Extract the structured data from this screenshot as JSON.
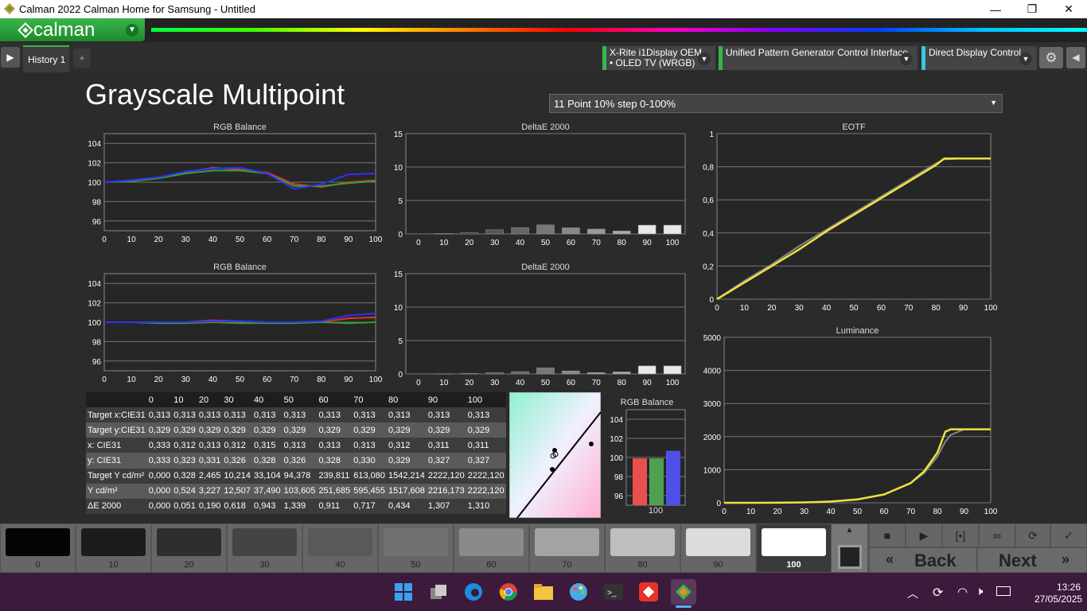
{
  "window": {
    "title": "Calman 2022 Calman Home for Samsung  - Untitled",
    "controls": [
      "—",
      "❐",
      "✕"
    ]
  },
  "app": {
    "logo_text": "calman"
  },
  "tabs": {
    "history": "History 1",
    "add": "+"
  },
  "devices": {
    "meter": [
      "X-Rite i1Display OEM",
      "• OLED TV (WRGB)"
    ],
    "generator": "Unified Pattern Generator Control Interface",
    "display": "Direct Display Control"
  },
  "page": {
    "title": "Grayscale Multipoint",
    "preset": "11 Point 10% step 0-100%"
  },
  "charts": {
    "rgb1_title": "RGB Balance",
    "delta1_title": "DeltaE 2000",
    "eotf_title": "EOTF",
    "rgb2_title": "RGB Balance",
    "delta2_title": "DeltaE 2000",
    "lum_title": "Luminance",
    "rgbbar_title": "RGB Balance",
    "rgbbar_label": "100"
  },
  "chart_data": [
    {
      "type": "line",
      "title": "RGB Balance",
      "x": [
        0,
        10,
        20,
        30,
        40,
        50,
        60,
        70,
        80,
        90,
        100
      ],
      "ylim": [
        95,
        105
      ],
      "series": [
        {
          "color": "#e03030",
          "values": [
            100,
            100.2,
            100.5,
            101,
            101.5,
            101.3,
            101,
            99.8,
            99.5,
            100,
            100.2
          ]
        },
        {
          "color": "#30a030",
          "values": [
            100,
            100.1,
            100.4,
            100.9,
            101.2,
            101.2,
            100.9,
            99.6,
            99.6,
            99.9,
            100.1
          ]
        },
        {
          "color": "#3030ff",
          "values": [
            100,
            100.2,
            100.5,
            101.1,
            101.4,
            101.5,
            100.9,
            99.3,
            99.8,
            100.8,
            100.9
          ]
        }
      ]
    },
    {
      "type": "bar",
      "title": "DeltaE 2000",
      "categories": [
        "0",
        "10",
        "20",
        "30",
        "40",
        "50",
        "60",
        "70",
        "80",
        "90",
        "100"
      ],
      "values": [
        0,
        0.05,
        0.19,
        0.62,
        0.94,
        1.34,
        0.91,
        0.72,
        0.43,
        1.31,
        1.31
      ],
      "ylim": [
        0,
        15
      ]
    },
    {
      "type": "line",
      "title": "EOTF",
      "x": [
        0,
        10,
        20,
        30,
        40,
        50,
        60,
        70,
        80,
        83,
        90,
        100
      ],
      "ylim": [
        0,
        1
      ],
      "series": [
        {
          "color": "#888888",
          "values": [
            0,
            0.11,
            0.21,
            0.32,
            0.42,
            0.52,
            0.62,
            0.72,
            0.82,
            0.845,
            0.85,
            0.85
          ]
        },
        {
          "color": "#f0e040",
          "values": [
            0,
            0.1,
            0.2,
            0.3,
            0.41,
            0.51,
            0.61,
            0.71,
            0.81,
            0.85,
            0.85,
            0.85
          ]
        }
      ]
    },
    {
      "type": "line",
      "title": "RGB Balance",
      "x": [
        0,
        10,
        20,
        30,
        40,
        50,
        60,
        70,
        80,
        90,
        100
      ],
      "ylim": [
        95,
        105
      ],
      "series": [
        {
          "color": "#e03030",
          "values": [
            100,
            100,
            100,
            100,
            100.2,
            100.1,
            100,
            100,
            100,
            100.4,
            100.5
          ]
        },
        {
          "color": "#30a030",
          "values": [
            100,
            100,
            99.9,
            99.9,
            100,
            99.9,
            99.9,
            99.9,
            100,
            99.9,
            100
          ]
        },
        {
          "color": "#3030ff",
          "values": [
            100,
            100,
            100,
            100,
            100.1,
            100.1,
            100,
            100,
            100.1,
            100.7,
            100.9
          ]
        }
      ]
    },
    {
      "type": "bar",
      "title": "DeltaE 2000",
      "categories": [
        "0",
        "10",
        "20",
        "30",
        "40",
        "50",
        "60",
        "70",
        "80",
        "90",
        "100"
      ],
      "values": [
        0,
        0.02,
        0.1,
        0.2,
        0.35,
        0.9,
        0.45,
        0.2,
        0.3,
        1.2,
        1.2
      ],
      "ylim": [
        0,
        15
      ]
    },
    {
      "type": "line",
      "title": "Luminance",
      "x": [
        0,
        10,
        20,
        30,
        40,
        50,
        60,
        70,
        75,
        80,
        83,
        85,
        90,
        100
      ],
      "ylim": [
        0,
        5000
      ],
      "series": [
        {
          "color": "#888888",
          "values": [
            0,
            0.5,
            3,
            12.5,
            37,
            104,
            252,
            595,
            900,
            1400,
            1850,
            2050,
            2222,
            2222
          ]
        },
        {
          "color": "#f0e040",
          "values": [
            0,
            0.5,
            3.2,
            12.5,
            37.5,
            103.6,
            251.7,
            595.5,
            950,
            1517,
            2150,
            2222,
            2222,
            2222
          ]
        }
      ]
    },
    {
      "type": "bar",
      "title": "RGB Balance",
      "categories": [
        "100"
      ],
      "series": [
        {
          "color": "#e85050",
          "values": [
            99.9
          ]
        },
        {
          "color": "#50a050",
          "values": [
            99.9
          ]
        },
        {
          "color": "#5050e8",
          "values": [
            100.7
          ]
        }
      ],
      "ylim": [
        95,
        105
      ]
    }
  ],
  "table": {
    "headers": [
      "",
      "0",
      "10",
      "20",
      "30",
      "40",
      "50",
      "60",
      "70",
      "80",
      "90",
      "100"
    ],
    "rows": [
      [
        "Target x:CIE31",
        "0,313",
        "0,313",
        "0,313",
        "0,313",
        "0,313",
        "0,313",
        "0,313",
        "0,313",
        "0,313",
        "0,313",
        "0,313"
      ],
      [
        "Target y:CIE31",
        "0,329",
        "0,329",
        "0,329",
        "0,329",
        "0,329",
        "0,329",
        "0,329",
        "0,329",
        "0,329",
        "0,329",
        "0,329"
      ],
      [
        "x: CIE31",
        "0,333",
        "0,312",
        "0,313",
        "0,312",
        "0,315",
        "0,313",
        "0,313",
        "0,313",
        "0,312",
        "0,311",
        "0,311"
      ],
      [
        "y: CIE31",
        "0,333",
        "0,323",
        "0,331",
        "0,326",
        "0,328",
        "0,326",
        "0,328",
        "0,330",
        "0,329",
        "0,327",
        "0,327"
      ],
      [
        "Target Y cd/m²",
        "0,000",
        "0,328",
        "2,465",
        "10,214",
        "33,104",
        "94,378",
        "239,811",
        "613,080",
        "1542,214",
        "2222,120",
        "2222,120"
      ],
      [
        "Y cd/m²",
        "0,000",
        "0,524",
        "3,227",
        "12,507",
        "37,490",
        "103,605",
        "251,685",
        "595,455",
        "1517,608",
        "2216,173",
        "2222,120"
      ],
      [
        "ΔE 2000",
        "0,000",
        "0,051",
        "0,190",
        "0,618",
        "0,943",
        "1,339",
        "0,911",
        "0,717",
        "0,434",
        "1,307",
        "1,310"
      ]
    ]
  },
  "swatches": [
    {
      "label": "0",
      "color": "#050505"
    },
    {
      "label": "10",
      "color": "#1c1c1c"
    },
    {
      "label": "20",
      "color": "#2e2e2e"
    },
    {
      "label": "30",
      "color": "#444444"
    },
    {
      "label": "40",
      "color": "#595959"
    },
    {
      "label": "50",
      "color": "#707070"
    },
    {
      "label": "60",
      "color": "#8a8a8a"
    },
    {
      "label": "70",
      "color": "#a3a3a3"
    },
    {
      "label": "80",
      "color": "#bebebe"
    },
    {
      "label": "90",
      "color": "#dcdcdc"
    },
    {
      "label": "100",
      "color": "#ffffff"
    }
  ],
  "nav": {
    "back": "Back",
    "next": "Next"
  },
  "clock": {
    "time": "13:26",
    "date": "27/05/2025"
  }
}
